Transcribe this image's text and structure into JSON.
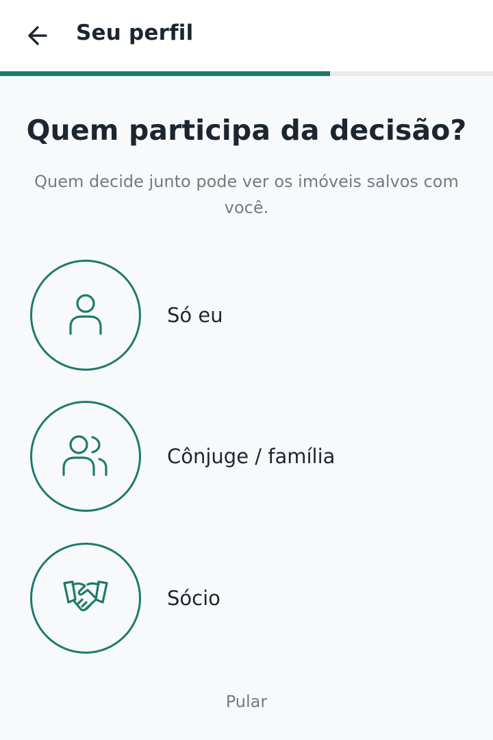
{
  "header": {
    "title": "Seu perfil",
    "back_icon": "arrow-left-icon"
  },
  "progress": {
    "fraction": 0.67
  },
  "main": {
    "question": "Quem participa da decisão?",
    "subtitle": "Quem decide junto pode ver os imóveis salvos com você."
  },
  "options": [
    {
      "label": "Só eu",
      "icon": "person-icon"
    },
    {
      "label": "Cônjuge / família",
      "icon": "people-icon"
    },
    {
      "label": "Sócio",
      "icon": "handshake-icon"
    }
  ],
  "footer": {
    "skip_label": "Pular"
  },
  "colors": {
    "accent": "#1d7a6c",
    "text": "#1c2632",
    "muted": "#707b86",
    "background": "#f7f9fb"
  }
}
